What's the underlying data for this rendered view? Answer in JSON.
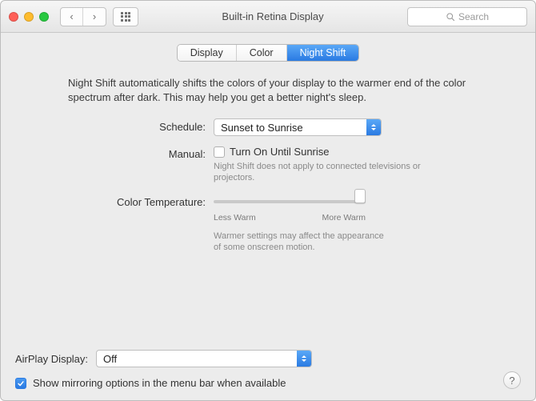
{
  "window": {
    "title": "Built-in Retina Display",
    "search_placeholder": "Search"
  },
  "tabs": {
    "display": "Display",
    "color": "Color",
    "night_shift": "Night Shift",
    "active": "night_shift"
  },
  "night_shift": {
    "description": "Night Shift automatically shifts the colors of your display to the warmer end of the color spectrum after dark. This may help you get a better night's sleep.",
    "schedule": {
      "label": "Schedule:",
      "value": "Sunset to Sunrise"
    },
    "manual": {
      "label": "Manual:",
      "checkbox_checked": false,
      "checkbox_label": "Turn On Until Sunrise",
      "hint": "Night Shift does not apply to connected televisions or projectors."
    },
    "color_temp": {
      "label": "Color Temperature:",
      "min_label": "Less Warm",
      "max_label": "More Warm",
      "value_percent": 100,
      "hint": "Warmer settings may affect the appearance of some onscreen motion."
    }
  },
  "footer": {
    "airplay_label": "AirPlay Display:",
    "airplay_value": "Off",
    "mirroring_checked": true,
    "mirroring_label": "Show mirroring options in the menu bar when available",
    "help": "?"
  }
}
